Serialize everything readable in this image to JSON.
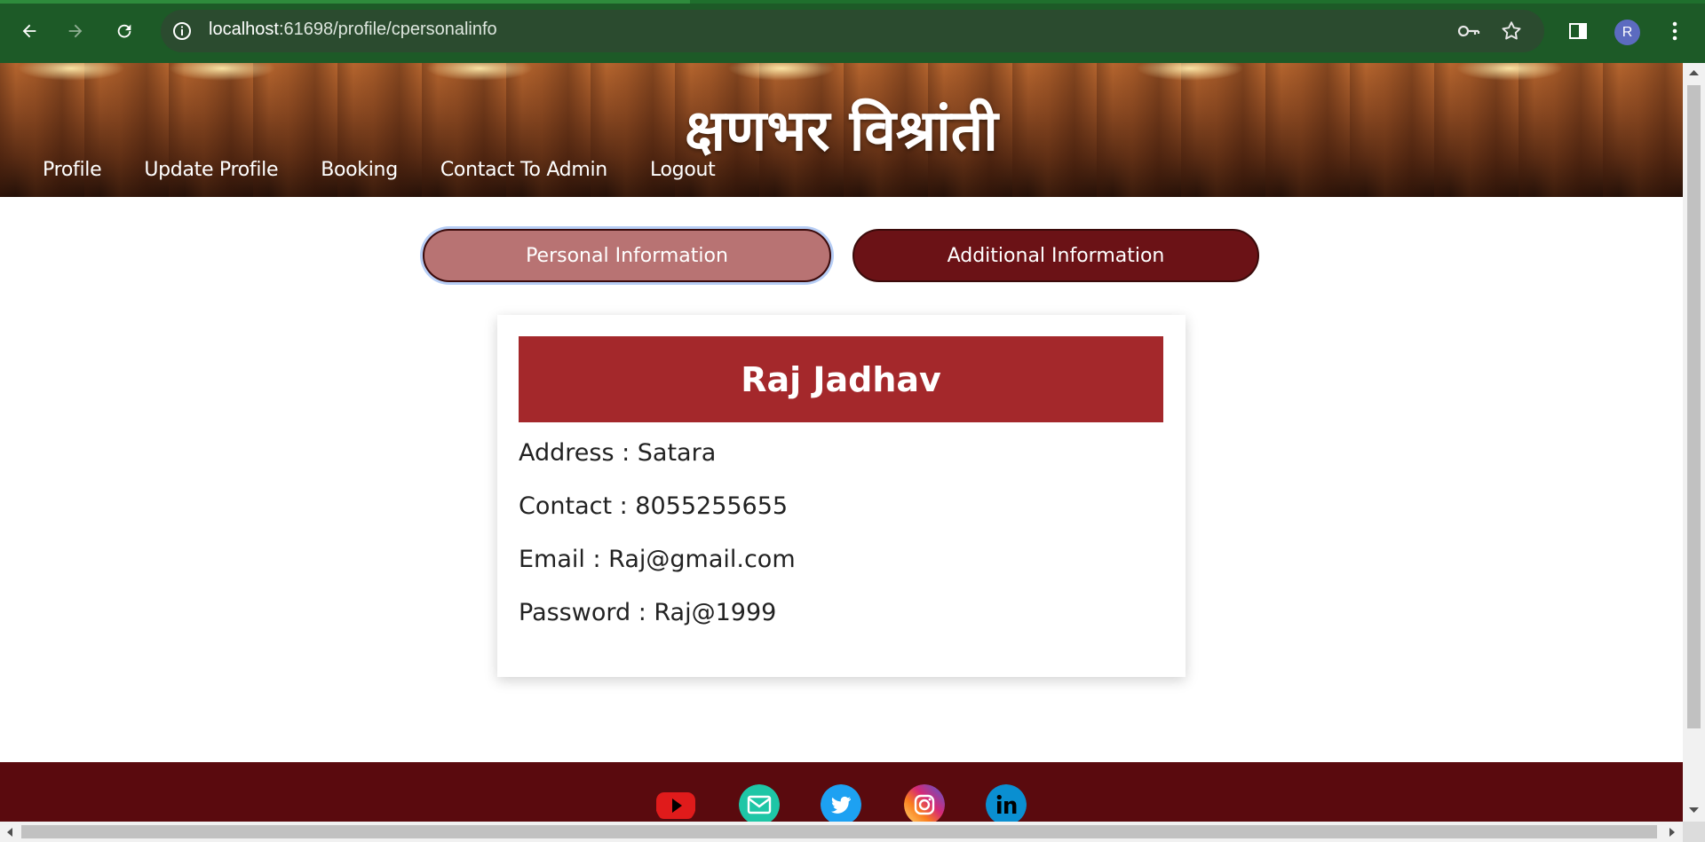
{
  "browser": {
    "url_host": "localhost",
    "url_rest": ":61698/profile/cpersonalinfo",
    "avatar_letter": "R",
    "accent_color": "#1d5a27"
  },
  "site": {
    "title": "क्षणभर विश्रांती",
    "menu": [
      "Profile",
      "Update Profile",
      "Booking",
      "Contact To Admin",
      "Logout"
    ]
  },
  "tabs": {
    "personal": "Personal Information",
    "additional": "Additional Information"
  },
  "profile": {
    "name": "Raj Jadhav",
    "fields": [
      "Address : Satara",
      "Contact : 8055255655",
      "Email : Raj@gmail.com",
      "Password : Raj@1999"
    ]
  },
  "footer": {
    "social_icons": [
      "youtube-icon",
      "email-icon",
      "twitter-icon",
      "instagram-icon",
      "linkedin-icon"
    ]
  },
  "colors": {
    "name_bar": "#a4282b",
    "footer": "#5a0a0e",
    "tab_active": "#b87373",
    "tab_inactive": "#6b1216"
  }
}
